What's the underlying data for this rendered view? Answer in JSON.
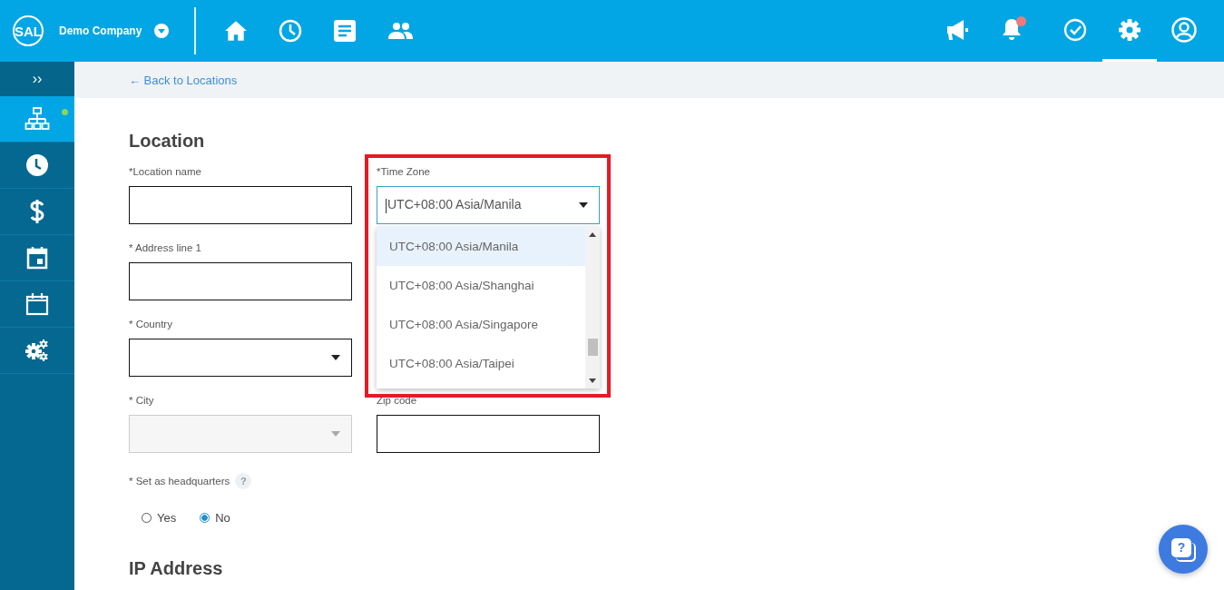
{
  "header": {
    "logo": "SAL",
    "company": "Demo Company",
    "nav_icons": [
      {
        "kind": "home"
      },
      {
        "kind": "clock"
      },
      {
        "kind": "document"
      },
      {
        "kind": "people"
      }
    ],
    "tool_icons": [
      {
        "kind": "megaphone",
        "selected": false,
        "unread": false
      },
      {
        "kind": "bell",
        "selected": false,
        "unread": true
      },
      {
        "kind": "check",
        "selected": false,
        "unread": false
      },
      {
        "kind": "settings",
        "selected": true,
        "unread": false
      },
      {
        "kind": "account",
        "selected": false,
        "unread": false
      }
    ]
  },
  "sidebar": {
    "toggle": "››",
    "items": [
      {
        "kind": "org",
        "selected": true,
        "unread": true
      },
      {
        "kind": "clock",
        "selected": false,
        "unread": false
      },
      {
        "kind": "dollar",
        "selected": false,
        "unread": false
      },
      {
        "kind": "calendar-day",
        "selected": false,
        "unread": false
      },
      {
        "kind": "calendar",
        "selected": false,
        "unread": false
      },
      {
        "kind": "gears",
        "selected": false,
        "unread": false
      }
    ]
  },
  "breadcrumb": "← Back to Locations",
  "form": {
    "title": "Location",
    "rows": [
      [
        {
          "kind": "text",
          "label": "*Location name",
          "disabled": false
        },
        {
          "kind": "select",
          "label": "*Time Zone",
          "value": "UTC+08:00 Asia/Manila",
          "disabled": false,
          "expanded": true
        }
      ],
      [
        {
          "kind": "text",
          "label": "* Address line 1",
          "disabled": false
        }
      ],
      [
        {
          "kind": "select",
          "label": "* Country",
          "disabled": false,
          "expanded": false
        }
      ],
      [
        {
          "kind": "select",
          "label": "* City",
          "disabled": true,
          "expanded": false
        },
        {
          "kind": "text",
          "label": "Zip code",
          "disabled": false
        }
      ]
    ],
    "open_dropdown": {
      "options": [
        {
          "label": "UTC+08:00 Asia/Manila",
          "selected": true
        },
        {
          "label": "UTC+08:00 Asia/Shanghai",
          "selected": false
        },
        {
          "label": "UTC+08:00 Asia/Singapore",
          "selected": false
        },
        {
          "label": "UTC+08:00 Asia/Taipei",
          "selected": false
        }
      ]
    },
    "headquarters": {
      "label": "* Set as headquarters",
      "help": "?",
      "options": [
        {
          "label": "Yes",
          "selected": false
        },
        {
          "label": "No",
          "selected": true
        }
      ]
    },
    "next_section": "IP Address"
  },
  "help_button": {
    "label": "?"
  }
}
